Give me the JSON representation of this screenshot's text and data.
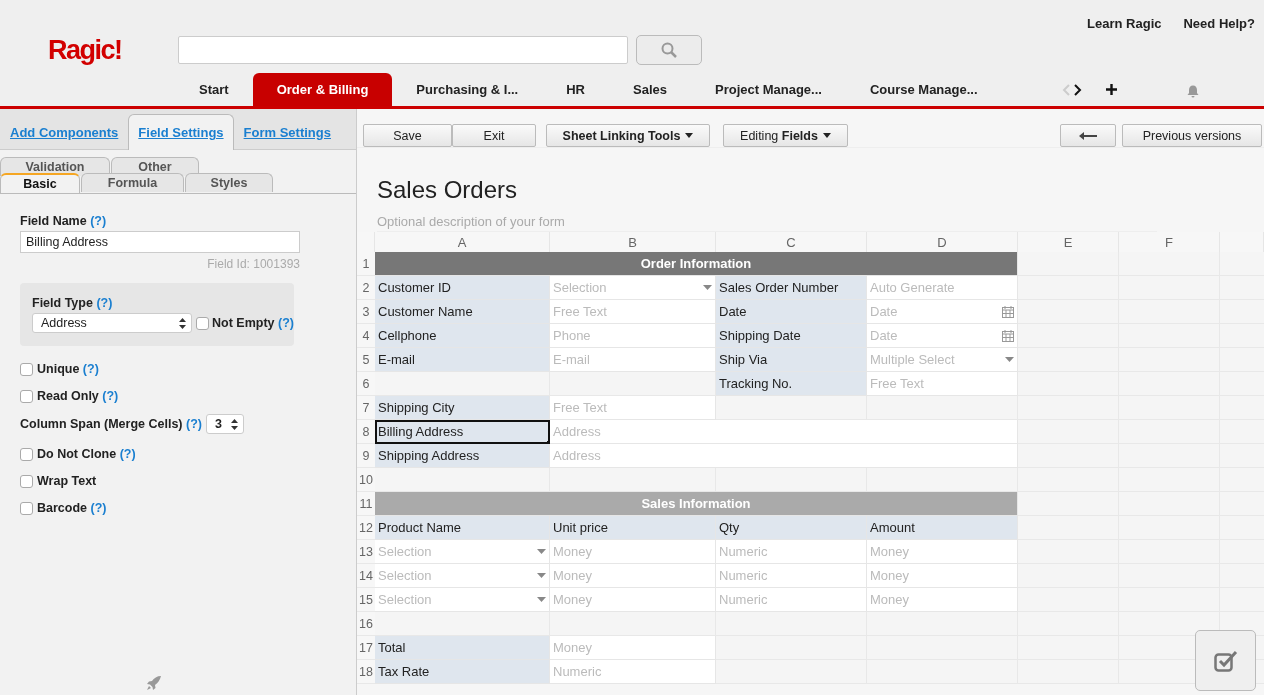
{
  "header": {
    "logo": "Ragic!",
    "links": [
      "Learn Ragic",
      "Need Help?"
    ]
  },
  "nav": {
    "tabs": [
      {
        "label": "Start",
        "selected": false
      },
      {
        "label": "Order & Billing",
        "selected": true
      },
      {
        "label": "Purchasing & I...",
        "selected": false
      },
      {
        "label": "HR",
        "selected": false
      },
      {
        "label": "Sales",
        "selected": false
      },
      {
        "label": "Project Manage...",
        "selected": false
      },
      {
        "label": "Course Manage...",
        "selected": false
      }
    ],
    "prev_disabled": true,
    "next_disabled": false
  },
  "left_panel": {
    "tabs": [
      {
        "label": "Add Components",
        "selected": false
      },
      {
        "label": "Field Settings",
        "selected": true
      },
      {
        "label": "Form Settings",
        "selected": false
      }
    ],
    "subtabs_back": [
      {
        "label": "Validation",
        "selected": false
      },
      {
        "label": "Other",
        "selected": false
      }
    ],
    "subtabs_front": [
      {
        "label": "Basic",
        "selected": true
      },
      {
        "label": "Formula",
        "selected": false
      },
      {
        "label": "Styles",
        "selected": false
      }
    ],
    "field_name": {
      "label": "Field Name",
      "help": "(?)",
      "value": "Billing Address",
      "field_id": "Field Id: 1001393"
    },
    "field_type": {
      "label": "Field Type",
      "help": "(?)",
      "value": "Address",
      "not_empty": {
        "label": "Not Empty",
        "help": "(?)",
        "checked": false
      }
    },
    "options": [
      {
        "kind": "checkbox",
        "label": "Unique",
        "help": "(?)",
        "checked": false
      },
      {
        "kind": "checkbox",
        "label": "Read Only",
        "help": "(?)",
        "checked": false
      },
      {
        "kind": "select",
        "label": "Column Span (Merge Cells)",
        "help": "(?)",
        "value": "3"
      },
      {
        "kind": "checkbox",
        "label": "Do Not Clone",
        "help": "(?)",
        "checked": false
      },
      {
        "kind": "checkbox",
        "label": "Wrap Text",
        "checked": false
      },
      {
        "kind": "checkbox",
        "label": "Barcode",
        "help": "(?)",
        "checked": false
      }
    ]
  },
  "toolbar": {
    "left": [
      {
        "label": "Save",
        "dropdown": false
      },
      {
        "label": "Exit",
        "dropdown": false
      },
      {
        "label": "Sheet Linking Tools",
        "dropdown": true
      },
      {
        "label": "Editing **Fields**",
        "dropdown": true
      }
    ],
    "right": [
      "Previous versions"
    ]
  },
  "form": {
    "title": "Sales Orders",
    "description": {
      "placeholder": "Optional description of your form"
    }
  },
  "sheet": {
    "columns": [
      "A",
      "B",
      "C",
      "D",
      "E",
      "F"
    ],
    "rows": [
      {
        "num": "1",
        "cells": [
          {
            "kind": "header",
            "text": "Order Information"
          }
        ]
      },
      {
        "num": "2",
        "cells": [
          {
            "kind": "label",
            "text": "Customer ID",
            "selected": false
          },
          {
            "kind": "select_placeholder",
            "text": "Selection",
            "selected": false
          },
          {
            "kind": "label",
            "text": "Sales Order Number",
            "selected": false
          },
          {
            "kind": "placeholder",
            "text": "Auto Generate",
            "selected": false
          }
        ]
      },
      {
        "num": "3",
        "cells": [
          {
            "kind": "label",
            "text": "Customer Name",
            "selected": false
          },
          {
            "kind": "placeholder",
            "text": "Free Text",
            "selected": false
          },
          {
            "kind": "label",
            "text": "Date",
            "selected": false
          },
          {
            "kind": "date_placeholder",
            "text": "Date",
            "selected": false
          }
        ]
      },
      {
        "num": "4",
        "cells": [
          {
            "kind": "label",
            "text": "Cellphone",
            "selected": false
          },
          {
            "kind": "placeholder",
            "text": "Phone",
            "selected": false
          },
          {
            "kind": "label",
            "text": "Shipping Date",
            "selected": false
          },
          {
            "kind": "date_placeholder",
            "text": "Date",
            "selected": false
          }
        ]
      },
      {
        "num": "5",
        "cells": [
          {
            "kind": "label",
            "text": "E-mail",
            "selected": false
          },
          {
            "kind": "placeholder",
            "text": "E-mail",
            "selected": false
          },
          {
            "kind": "label",
            "text": "Ship Via",
            "selected": false
          },
          {
            "kind": "select_placeholder",
            "text": "Multiple Select",
            "selected": false
          }
        ]
      },
      {
        "num": "6",
        "cells": [
          {
            "kind": "empty"
          },
          {
            "kind": "empty"
          },
          {
            "kind": "label",
            "text": "Tracking No.",
            "selected": false
          },
          {
            "kind": "placeholder",
            "text": "Free Text",
            "selected": false
          }
        ]
      },
      {
        "num": "7",
        "cells": [
          {
            "kind": "label",
            "text": "Shipping City",
            "selected": false
          },
          {
            "kind": "placeholder",
            "text": "Free Text",
            "selected": false
          },
          {
            "kind": "empty"
          },
          {
            "kind": "empty"
          }
        ]
      },
      {
        "num": "8",
        "cells": [
          {
            "kind": "label",
            "text": "Billing Address",
            "selected": true
          },
          {
            "kind": "placeholder",
            "text": "Address",
            "selected": false
          }
        ]
      },
      {
        "num": "9",
        "cells": [
          {
            "kind": "label",
            "text": "Shipping Address",
            "selected": false
          },
          {
            "kind": "placeholder",
            "text": "Address",
            "selected": false
          }
        ]
      },
      {
        "num": "10",
        "cells": [
          {
            "kind": "empty"
          },
          {
            "kind": "empty"
          },
          {
            "kind": "empty"
          },
          {
            "kind": "empty"
          }
        ]
      },
      {
        "num": "11",
        "cells": [
          {
            "kind": "subheader",
            "text": "Sales Information"
          }
        ]
      },
      {
        "num": "12",
        "cells": [
          {
            "kind": "label",
            "text": "Product Name",
            "selected": false
          },
          {
            "kind": "label",
            "text": "Unit price",
            "selected": false
          },
          {
            "kind": "label",
            "text": "Qty",
            "selected": false
          },
          {
            "kind": "label",
            "text": "Amount",
            "selected": false
          }
        ]
      },
      {
        "num": "13",
        "cells": [
          {
            "kind": "select_placeholder",
            "text": "Selection",
            "selected": false
          },
          {
            "kind": "placeholder",
            "text": "Money",
            "selected": false
          },
          {
            "kind": "placeholder",
            "text": "Numeric",
            "selected": false
          },
          {
            "kind": "placeholder",
            "text": "Money",
            "selected": false
          }
        ]
      },
      {
        "num": "14",
        "cells": [
          {
            "kind": "select_placeholder",
            "text": "Selection",
            "selected": false
          },
          {
            "kind": "placeholder",
            "text": "Money",
            "selected": false
          },
          {
            "kind": "placeholder",
            "text": "Numeric",
            "selected": false
          },
          {
            "kind": "placeholder",
            "text": "Money",
            "selected": false
          }
        ]
      },
      {
        "num": "15",
        "cells": [
          {
            "kind": "select_placeholder",
            "text": "Selection",
            "selected": false
          },
          {
            "kind": "placeholder",
            "text": "Money",
            "selected": false
          },
          {
            "kind": "placeholder",
            "text": "Numeric",
            "selected": false
          },
          {
            "kind": "placeholder",
            "text": "Money",
            "selected": false
          }
        ]
      },
      {
        "num": "16",
        "cells": [
          {
            "kind": "empty"
          },
          {
            "kind": "empty"
          },
          {
            "kind": "empty"
          },
          {
            "kind": "empty"
          }
        ]
      },
      {
        "num": "17",
        "cells": [
          {
            "kind": "label",
            "text": "Total",
            "selected": false
          },
          {
            "kind": "placeholder",
            "text": "Money",
            "selected": false
          },
          {
            "kind": "empty"
          },
          {
            "kind": "empty"
          }
        ]
      },
      {
        "num": "18",
        "cells": [
          {
            "kind": "label",
            "text": "Tax Rate",
            "selected": false
          },
          {
            "kind": "placeholder",
            "text": "Numeric",
            "selected": false
          },
          {
            "kind": "empty"
          },
          {
            "kind": "empty"
          }
        ]
      }
    ]
  }
}
